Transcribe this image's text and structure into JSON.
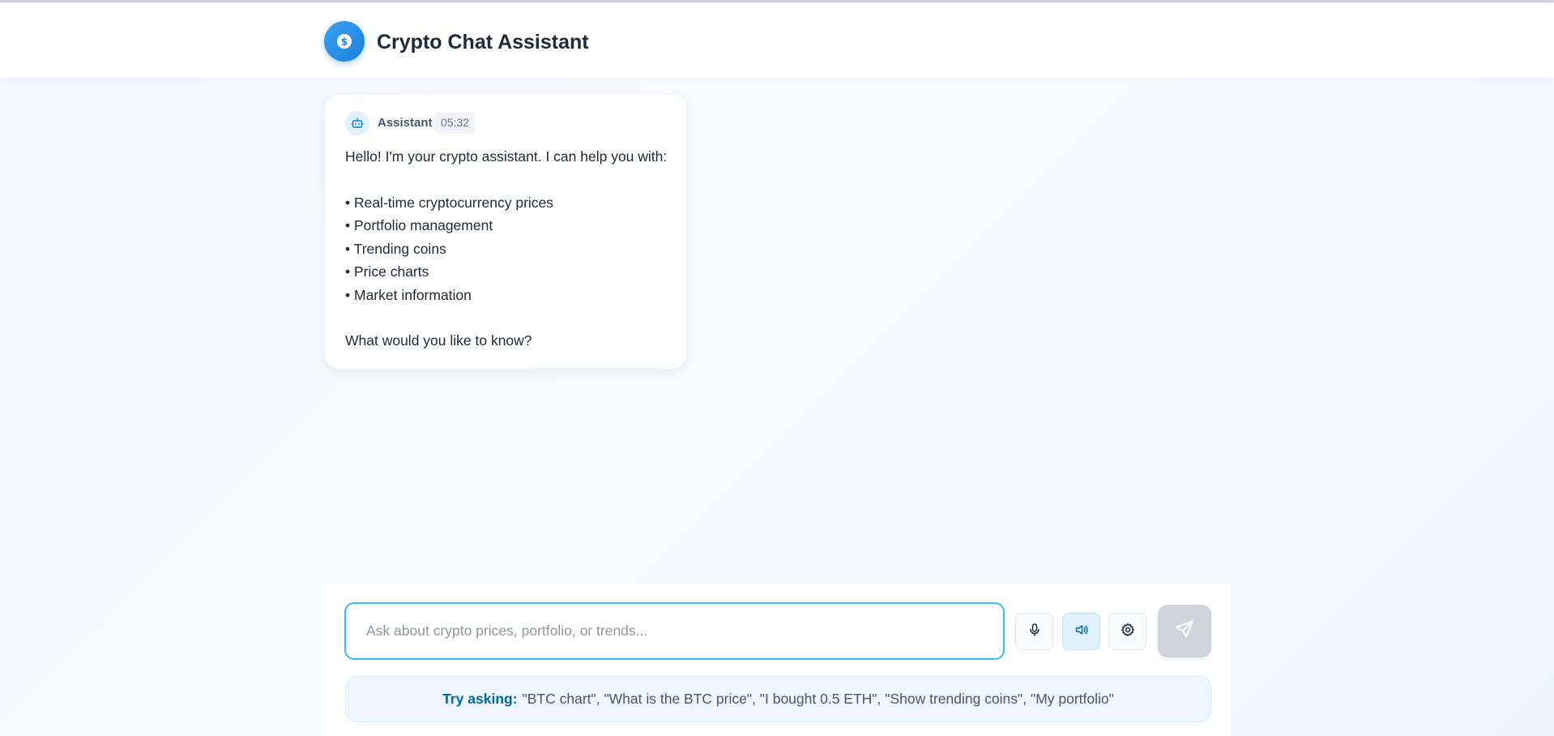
{
  "header": {
    "title": "Crypto Chat Assistant",
    "logo_icon": "dollar-coin-icon",
    "accent_color": "#1d7fe0"
  },
  "messages": [
    {
      "sender": "Assistant",
      "time": "05:32",
      "avatar_icon": "robot-icon",
      "lines": [
        "Hello! I'm your crypto assistant. I can help you with:",
        "• Real-time cryptocurrency prices",
        "• Portfolio management",
        "• Trending coins",
        "• Price charts",
        "• Market information",
        "What would you like to know?"
      ]
    }
  ],
  "composer": {
    "placeholder": "Ask about crypto prices, portfolio, or trends...",
    "value": "",
    "buttons": {
      "mic_icon": "microphone-icon",
      "speaker_icon": "speaker-icon",
      "settings_icon": "gear-icon",
      "send_icon": "send-icon"
    },
    "hint_lead": "Try asking:",
    "hint_text": "\"BTC chart\", \"What is the BTC price\", \"I bought 0.5 ETH\", \"Show trending coins\", \"My portfolio\""
  }
}
